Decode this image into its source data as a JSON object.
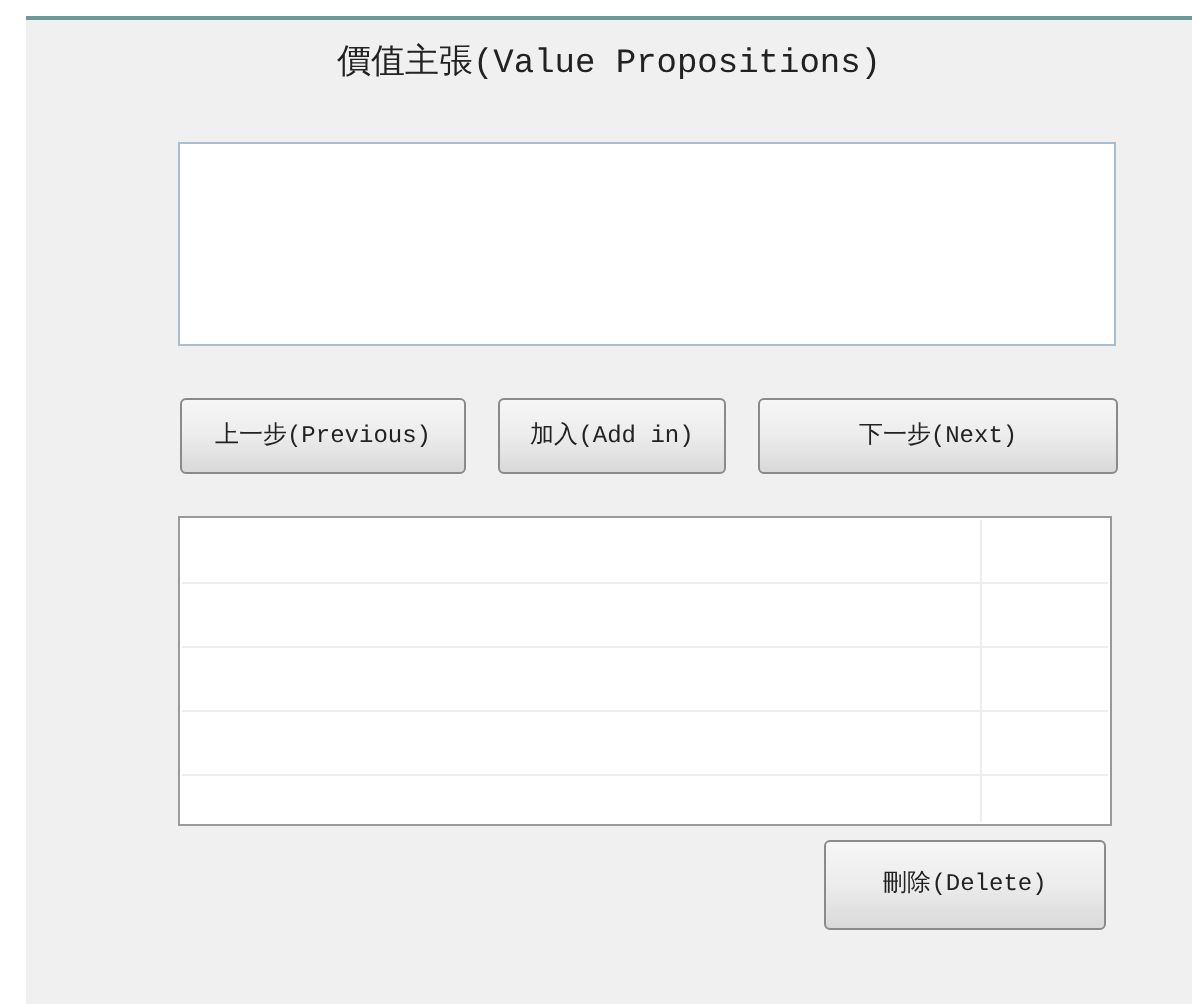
{
  "title": "價值主張(Value Propositions)",
  "buttons": [
    "上一步(Previous)",
    "加入(Add in)",
    "下一步(Next)"
  ],
  "delete_button": "刪除(Delete)"
}
